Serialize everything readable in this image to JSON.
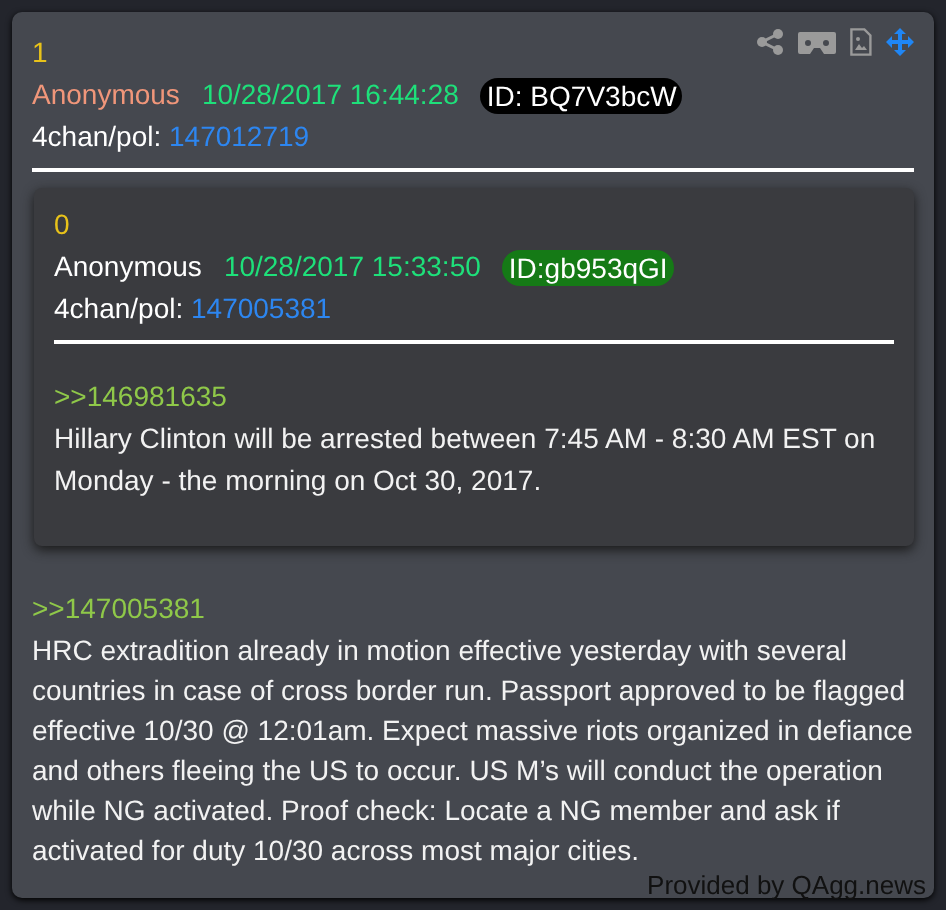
{
  "post": {
    "number": "1",
    "author": "Anonymous",
    "timestamp": "10/28/2017 16:44:28",
    "id": "ID: BQ7V3bcW",
    "source": "4chan/pol:",
    "post_link": "147012719",
    "quote": {
      "number": "0",
      "author": "Anonymous",
      "timestamp": "10/28/2017 15:33:50",
      "id": "ID:gb953qGI",
      "source": "4chan/pol:",
      "post_link": "147005381",
      "reply_to": ">>146981635",
      "body": "Hillary Clinton will be arrested between 7:45 AM - 8:30 AM EST on Monday - the morning on Oct 30, 2017."
    },
    "reply_to": ">>147005381",
    "body": "HRC extradition already in motion effective yesterday with several countries in case of cross border run. Passport approved to be flagged effective 10/30 @ 12:01am. Expect massive riots organized in defiance and others fleeing the US to occur. US M’s will conduct the operation while NG activated. Proof check: Locate a NG member and ask if activated for duty 10/30 across most major cities."
  },
  "footer": "Provided by QAgg.news"
}
